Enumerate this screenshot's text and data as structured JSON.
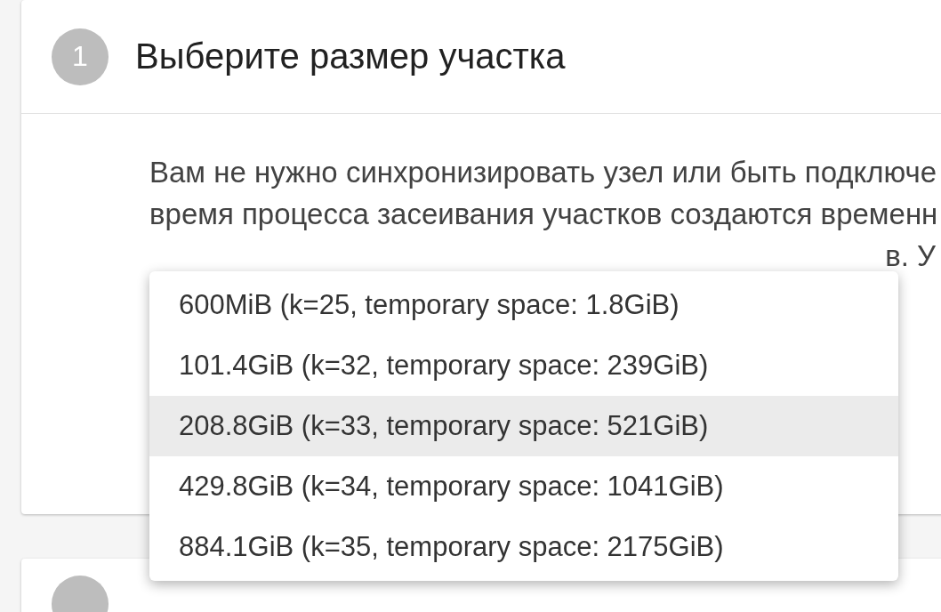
{
  "steps": [
    {
      "number": "1",
      "title": "Выберите размер участка",
      "lines": [
        "Вам не нужно синхронизировать узел или быть подключе",
        "время процесса засеивания участков создаются временн",
        "в. У"
      ],
      "menu": {
        "options": [
          {
            "label": "600MiB (k=25, temporary space: 1.8GiB)",
            "selected": false
          },
          {
            "label": "101.4GiB (k=32, temporary space: 239GiB)",
            "selected": false
          },
          {
            "label": "208.8GiB (k=33, temporary space: 521GiB)",
            "selected": true
          },
          {
            "label": "429.8GiB (k=34, temporary space: 1041GiB)",
            "selected": false
          },
          {
            "label": "884.1GiB (k=35, temporary space: 2175GiB)",
            "selected": false
          }
        ]
      }
    }
  ]
}
